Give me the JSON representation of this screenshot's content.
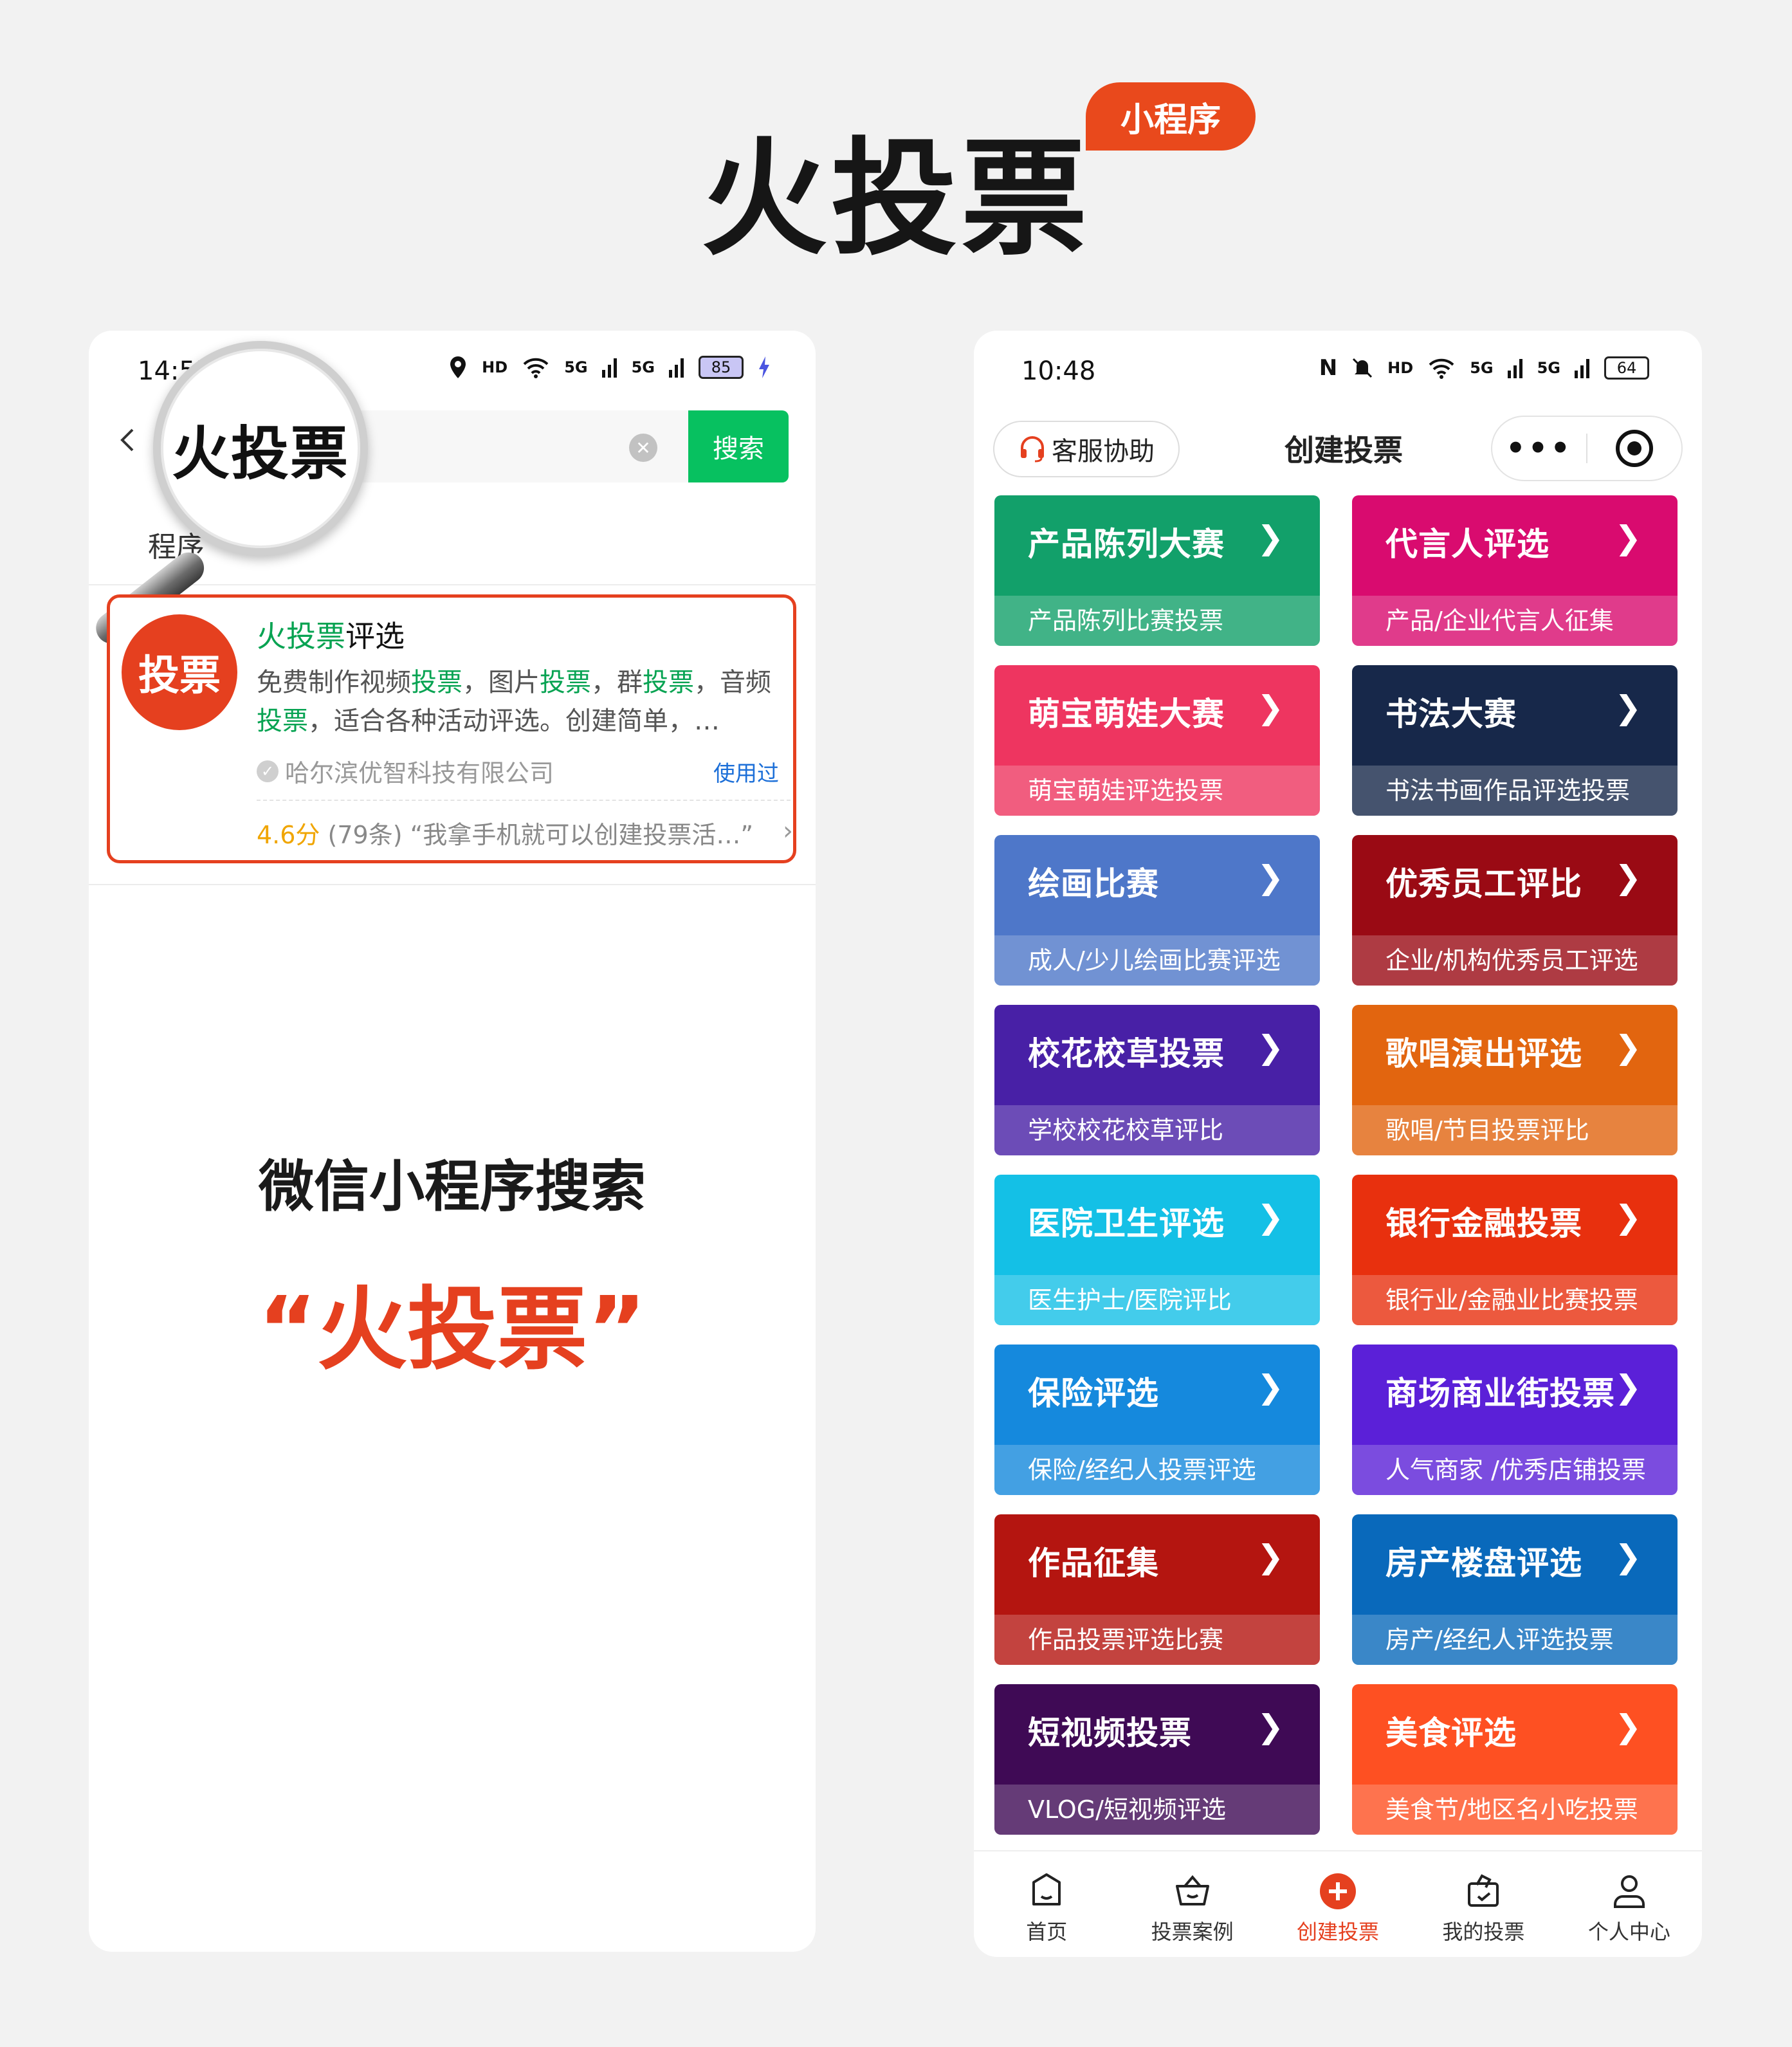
{
  "hero": {
    "title": "火投票",
    "badge": "小程序"
  },
  "left_phone": {
    "status": {
      "time": "14:55",
      "hd": "HD",
      "signal_1": "5G",
      "signal_2": "5G",
      "battery": "85"
    },
    "search": {
      "query": "火投票",
      "button": "搜索"
    },
    "tab_label": "程序",
    "result": {
      "logo_text": "投票",
      "name_highlight": "火投票",
      "name_rest": "评选",
      "desc": [
        {
          "t": "免费制作视频",
          "h": false
        },
        {
          "t": "投票",
          "h": true
        },
        {
          "t": "，图片",
          "h": false
        },
        {
          "t": "投票",
          "h": true
        },
        {
          "t": "，群",
          "h": false
        },
        {
          "t": "投票",
          "h": true
        },
        {
          "t": "，音频",
          "h": false
        },
        {
          "t": "投票",
          "h": true
        },
        {
          "t": "，适合各种活动评选。创建简单，…",
          "h": false
        }
      ],
      "company": "哈尔滨优智科技有限公司",
      "used_tag": "使用过",
      "rating": "4.6分",
      "rating_count": "(79条)",
      "review": "“我拿手机就可以创建投票活…”"
    },
    "caption_1": "微信小程序搜索",
    "caption_2": "“火投票”"
  },
  "right_phone": {
    "status": {
      "time": "10:48",
      "hd": "HD",
      "signal_1": "5G",
      "signal_2": "5G",
      "battery": "64"
    },
    "header": {
      "service_button": "客服协助",
      "title": "创建投票"
    },
    "tiles": [
      {
        "title": "产品陈列大赛",
        "sub": "产品陈列比赛投票",
        "color": "#12a06a"
      },
      {
        "title": "代言人评选",
        "sub": "产品/企业代言人征集",
        "color": "#d90b6f"
      },
      {
        "title": "萌宝萌娃大赛",
        "sub": "萌宝萌娃评选投票",
        "color": "#ee3560"
      },
      {
        "title": "书法大赛",
        "sub": "书法书画作品评选投票",
        "color": "#17284a"
      },
      {
        "title": "绘画比赛",
        "sub": "成人/少儿绘画比赛评选",
        "color": "#4e77c9"
      },
      {
        "title": "优秀员工评比",
        "sub": "企业/机构优秀员工评选",
        "color": "#9a0a14"
      },
      {
        "title": "校花校草投票",
        "sub": "学校校花校草评比",
        "color": "#4820a6"
      },
      {
        "title": "歌唱演出评选",
        "sub": "歌唱/节目投票评比",
        "color": "#e2650f"
      },
      {
        "title": "医院卫生评选",
        "sub": "医生护士/医院评比",
        "color": "#14c0e6"
      },
      {
        "title": "银行金融投票",
        "sub": "银行业/金融业比赛投票",
        "color": "#e8300e"
      },
      {
        "title": "保险评选",
        "sub": "保险/经纪人投票评选",
        "color": "#1589dd"
      },
      {
        "title": "商场商业街投票",
        "sub": "人气商家 /优秀店铺投票",
        "color": "#5b20d8"
      },
      {
        "title": "作品征集",
        "sub": "作品投票评选比赛",
        "color": "#b41510"
      },
      {
        "title": "房产楼盘评选",
        "sub": "房产/经纪人评选投票",
        "color": "#0969bb"
      },
      {
        "title": "短视频投票",
        "sub": "VLOG/短视频评选",
        "color": "#3f0a55"
      },
      {
        "title": "美食评选",
        "sub": "美食节/地区名小吃投票",
        "color": "#fe5022"
      }
    ],
    "tabbar": [
      {
        "label": "首页",
        "icon": "home-icon",
        "active": false
      },
      {
        "label": "投票案例",
        "icon": "basket-icon",
        "active": false
      },
      {
        "label": "创建投票",
        "icon": "plus-circle-icon",
        "active": true
      },
      {
        "label": "我的投票",
        "icon": "ballot-icon",
        "active": false
      },
      {
        "label": "个人中心",
        "icon": "user-icon",
        "active": false
      }
    ],
    "accent": "#e5401f"
  }
}
